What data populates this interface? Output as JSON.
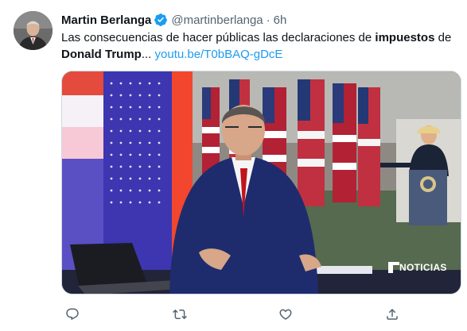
{
  "tweet": {
    "author_name": "Martin Berlanga",
    "handle": "@martinberlanga",
    "separator": "·",
    "time": "6h",
    "text_before": "Las consecuencias de hacer públicas las declaraciones de ",
    "text_bold1": "impuestos",
    "text_middle": " de ",
    "text_bold2": "Donald Trump",
    "text_ellipsis": "... ",
    "link": "youtu.be/T0bBAQ-gDcE"
  },
  "media": {
    "watermark": "NOTICIAS"
  },
  "actions": [
    {
      "icon": "reply-icon"
    },
    {
      "icon": "retweet-icon"
    },
    {
      "icon": "like-icon"
    },
    {
      "icon": "share-icon"
    }
  ],
  "colors": {
    "accent": "#1d9bf0",
    "secondary_text": "#536471",
    "verified_badge": "#1d9bf0"
  }
}
